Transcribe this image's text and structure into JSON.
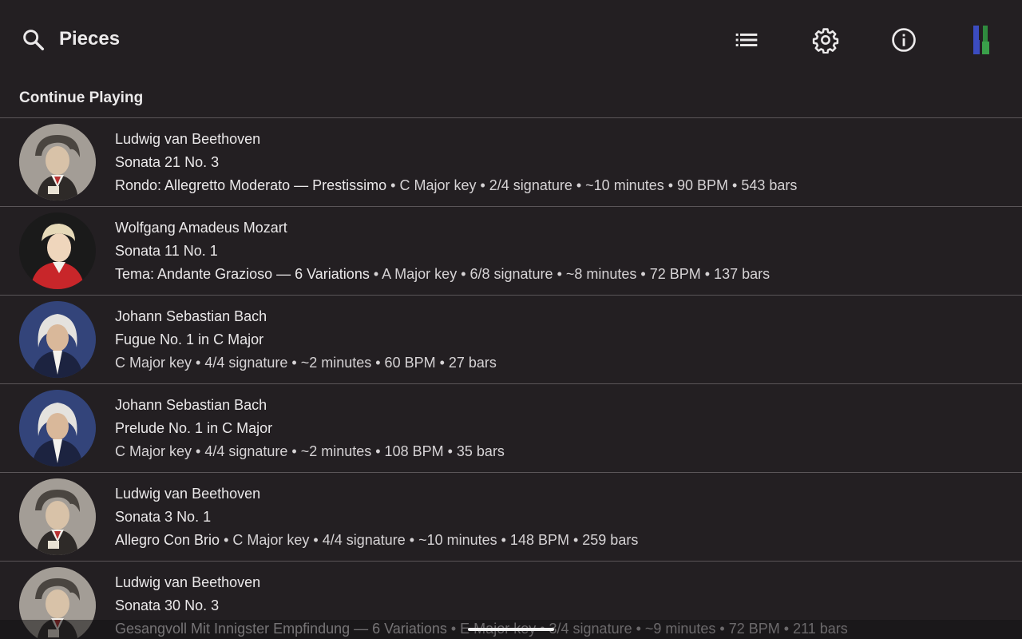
{
  "app": {
    "title": "Pieces",
    "icons": {
      "search": "search-icon",
      "list": "list-icon",
      "settings": "gear-icon",
      "info": "info-icon",
      "logo": "piano-logo-icon"
    }
  },
  "section": {
    "title": "Continue Playing"
  },
  "pieces": [
    {
      "composer": "Ludwig van Beethoven",
      "title": "Sonata 21 No. 3",
      "movement": "Rondo: Allegretto Moderato — Prestissimo",
      "meta": " • C Major key • 2/4 signature • ~10 minutes • 90 BPM • 543 bars",
      "portrait": "beethoven"
    },
    {
      "composer": "Wolfgang Amadeus Mozart",
      "title": "Sonata 11 No. 1",
      "movement": "Tema: Andante Grazioso — 6 Variations",
      "meta": " • A Major key • 6/8 signature • ~8 minutes • 72 BPM • 137 bars",
      "portrait": "mozart"
    },
    {
      "composer": "Johann Sebastian Bach",
      "title": "Fugue No. 1 in C Major",
      "movement": "",
      "meta": "C Major key • 4/4 signature • ~2 minutes • 60 BPM • 27 bars",
      "portrait": "bach"
    },
    {
      "composer": "Johann Sebastian Bach",
      "title": "Prelude No. 1 in C Major",
      "movement": "",
      "meta": "C Major key • 4/4 signature • ~2 minutes • 108 BPM • 35 bars",
      "portrait": "bach"
    },
    {
      "composer": "Ludwig van Beethoven",
      "title": "Sonata 3 No. 1",
      "movement": "Allegro Con Brio",
      "meta": " • C Major key • 4/4 signature • ~10 minutes • 148 BPM • 259 bars",
      "portrait": "beethoven"
    },
    {
      "composer": "Ludwig van Beethoven",
      "title": "Sonata 30 No. 3",
      "movement": "Gesangvoll Mit Innigster Empfindung — 6 Variations",
      "meta": " • E Major key • 3/4 signature • ~9 minutes • 72 BPM • 211 bars",
      "portrait": "beethoven"
    }
  ],
  "colors": {
    "background": "#231f22",
    "divider": "#5a5558",
    "text": "#ebe9ea",
    "logo_blue": "#3b4cc0",
    "logo_green": "#3aa04a"
  }
}
